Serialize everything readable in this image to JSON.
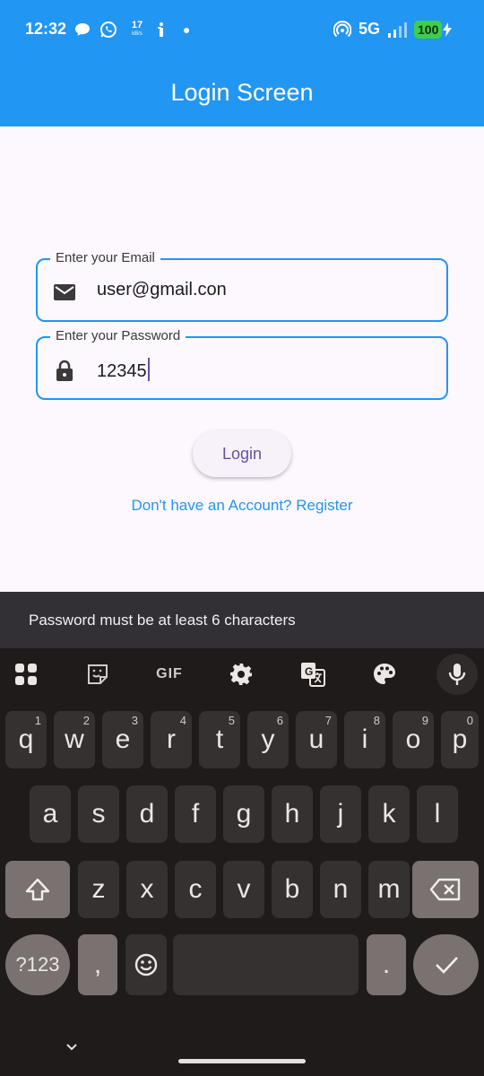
{
  "status_bar": {
    "time": "12:32",
    "net_speed_value": "17",
    "net_speed_unit": "kB/s",
    "network": "5G",
    "battery": "100"
  },
  "app_bar": {
    "title": "Login Screen",
    "color": "#2196f3"
  },
  "form": {
    "email": {
      "label": "Enter your Email",
      "value": "user@gmail.con",
      "icon": "mail-icon"
    },
    "password": {
      "label": "Enter your Password",
      "value": "12345",
      "icon": "lock-icon"
    },
    "login_label": "Login",
    "register_link": "Don't have an Account? Register"
  },
  "snackbar": {
    "message": "Password must be at least 6 characters"
  },
  "keyboard": {
    "toolbar": [
      "apps-grid-icon",
      "sticker-icon",
      "GIF",
      "settings-icon",
      "translate-icon",
      "palette-icon",
      "mic-icon"
    ],
    "gif_label": "GIF",
    "row1": [
      {
        "k": "q",
        "h": "1"
      },
      {
        "k": "w",
        "h": "2"
      },
      {
        "k": "e",
        "h": "3"
      },
      {
        "k": "r",
        "h": "4"
      },
      {
        "k": "t",
        "h": "5"
      },
      {
        "k": "y",
        "h": "6"
      },
      {
        "k": "u",
        "h": "7"
      },
      {
        "k": "i",
        "h": "8"
      },
      {
        "k": "o",
        "h": "9"
      },
      {
        "k": "p",
        "h": "0"
      }
    ],
    "row2": [
      "a",
      "s",
      "d",
      "f",
      "g",
      "h",
      "j",
      "k",
      "l"
    ],
    "row3": [
      "z",
      "x",
      "c",
      "v",
      "b",
      "n",
      "m"
    ],
    "symbols_label": "?123",
    "comma": ",",
    "period": "."
  }
}
